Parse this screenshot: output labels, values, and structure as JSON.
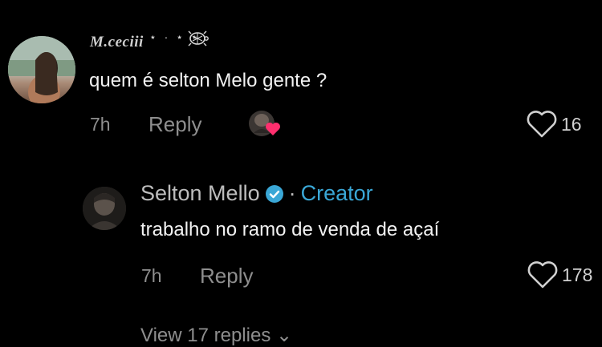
{
  "comments": [
    {
      "username": "M.ceciii",
      "decoration": "⋆ · ⋆ ⋆",
      "text": "quem é selton Melo gente ?",
      "time": "7h",
      "reply_label": "Reply",
      "likes": "16"
    },
    {
      "username": "Selton Mello",
      "creator_label": "Creator",
      "separator": "·",
      "text": "trabalho no ramo de venda de açaí",
      "time": "7h",
      "reply_label": "Reply",
      "likes": "178"
    }
  ],
  "view_replies": "View 17 replies ⌄",
  "colors": {
    "background": "#000000",
    "creator_accent": "#3aa7d6",
    "verified_badge": "#3aa7d6",
    "heart_pink": "#ff2f6e"
  },
  "icons": [
    "heart-outline-icon",
    "verified-badge-icon",
    "creator-liked-heart-icon",
    "turtle-icon"
  ]
}
